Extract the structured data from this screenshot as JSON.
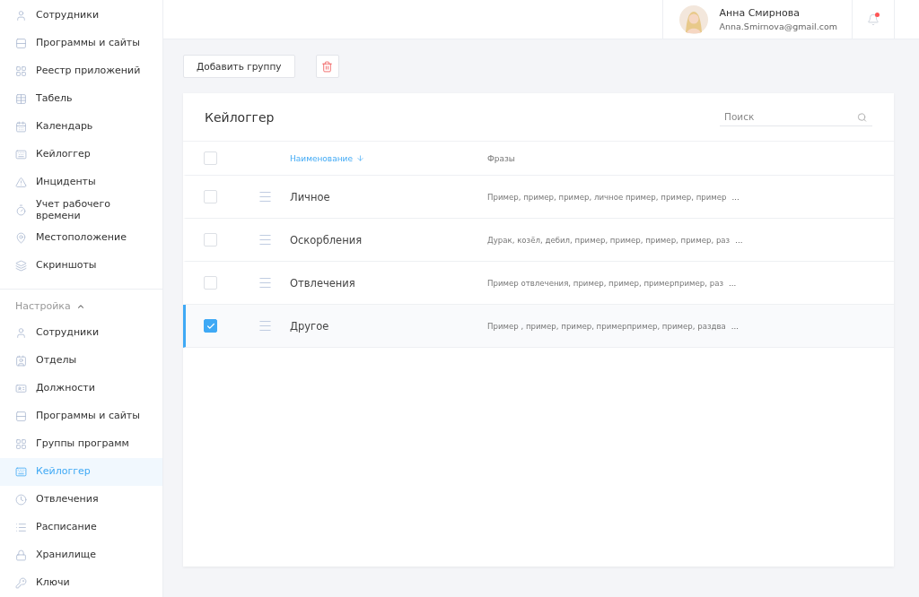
{
  "sidebar": {
    "main_items": [
      {
        "label": "Сотрудники",
        "selected": false
      },
      {
        "label": "Программы и сайты",
        "selected": false
      },
      {
        "label": "Реестр приложений",
        "selected": false
      },
      {
        "label": "Табель",
        "selected": false
      },
      {
        "label": "Календарь",
        "selected": false
      },
      {
        "label": "Кейлоггер",
        "selected": false
      },
      {
        "label": "Инциденты",
        "selected": false
      },
      {
        "label": "Учет рабочего времени",
        "selected": false
      },
      {
        "label": "Местоположение",
        "selected": false
      },
      {
        "label": "Скриншоты",
        "selected": false
      }
    ],
    "section": {
      "label": "Настройка",
      "expanded": true
    },
    "settings_items": [
      {
        "label": "Сотрудники",
        "selected": false
      },
      {
        "label": "Отделы",
        "selected": false
      },
      {
        "label": "Должности",
        "selected": false
      },
      {
        "label": "Программы и сайты",
        "selected": false
      },
      {
        "label": "Группы программ",
        "selected": false
      },
      {
        "label": "Кейлоггер",
        "selected": true
      },
      {
        "label": "Отвлечения",
        "selected": false
      },
      {
        "label": "Расписание",
        "selected": false
      },
      {
        "label": "Хранилище",
        "selected": false
      },
      {
        "label": "Ключи",
        "selected": false
      }
    ]
  },
  "header": {
    "user_name": "Анна Смирнова",
    "user_email": "Anna.Smirnova@gmail.com",
    "notifications_unread": true
  },
  "toolbar": {
    "add_button": "Добавить группу"
  },
  "card": {
    "title": "Кейлоггер",
    "search": {
      "placeholder": "Поиск"
    },
    "table": {
      "columns": [
        {
          "label": "Наименование",
          "sorted": true
        },
        {
          "label": "Фразы",
          "sorted": false
        }
      ],
      "all_checked": false,
      "rows": [
        {
          "name": "Личное",
          "phrases": "Пример, пример, пример, личное пример, пример, пример",
          "more": "...",
          "checked": false
        },
        {
          "name": "Оскорбления",
          "phrases": "Дурак, козёл, дебил, пример, пример, пример, пример, раз",
          "more": "...",
          "checked": false
        },
        {
          "name": "Отвлечения",
          "phrases": "Пример отвлечения, пример, пример, примерпример, раз",
          "more": "...",
          "checked": false
        },
        {
          "name": "Другое",
          "phrases": "Пример , пример, пример, примерпример, пример, раздва",
          "more": "...",
          "checked": true
        }
      ]
    }
  }
}
